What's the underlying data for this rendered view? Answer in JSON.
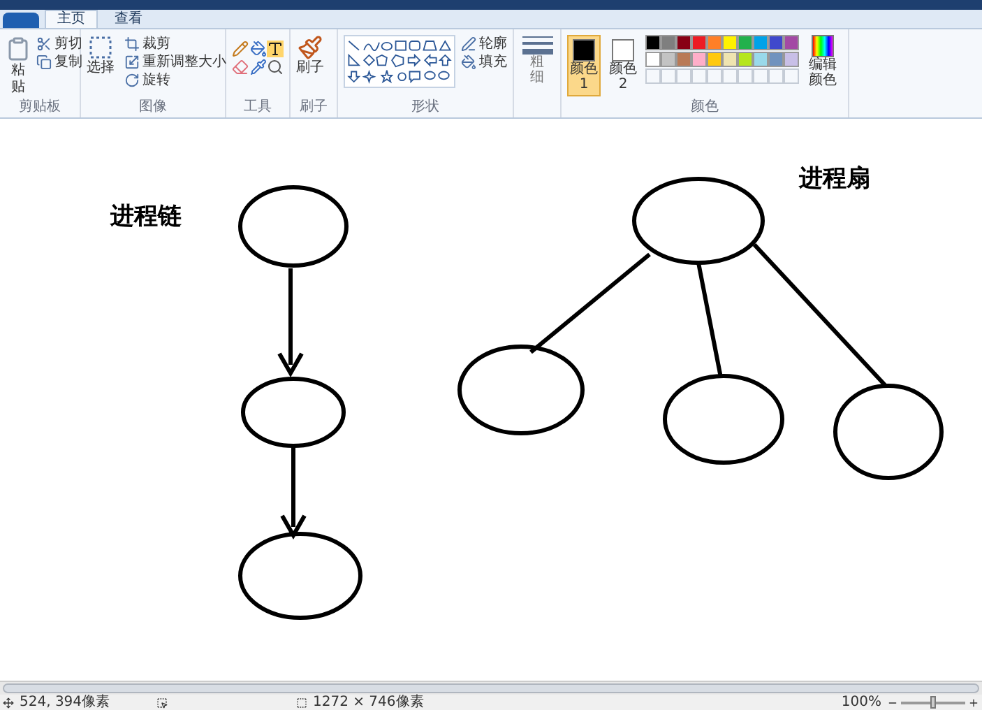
{
  "tabs": [
    {
      "label": "主页",
      "selected": true
    },
    {
      "label": "查看",
      "selected": false
    }
  ],
  "ribbon": {
    "clipboard": {
      "label": "剪贴板",
      "paste": "粘贴",
      "cut": "剪切",
      "copy": "复制"
    },
    "image": {
      "label": "图像",
      "select": "选择",
      "crop": "裁剪",
      "resize": "重新调整大小",
      "rotate": "旋转"
    },
    "tools": {
      "label": "工具"
    },
    "brushes": {
      "label": "刷子",
      "button": "刷子"
    },
    "shapes": {
      "label": "形状",
      "outline": "轮廓",
      "fill": "填充"
    },
    "size": {
      "label": "粗细"
    },
    "colors": {
      "label": "颜色",
      "edit": "编辑颜色",
      "slots": [
        {
          "label": "颜色 1",
          "color": "#000000",
          "selected": true
        },
        {
          "label": "颜色 2",
          "color": "#ffffff",
          "selected": false
        }
      ],
      "palette": [
        {
          "color": "#000000"
        },
        {
          "color": "#7f7f7f"
        },
        {
          "color": "#880015"
        },
        {
          "color": "#ed1c24"
        },
        {
          "color": "#ff7f27"
        },
        {
          "color": "#fff200"
        },
        {
          "color": "#22b14c"
        },
        {
          "color": "#00a2e8"
        },
        {
          "color": "#3f48cc"
        },
        {
          "color": "#a349a4"
        },
        {
          "color": "#ffffff"
        },
        {
          "color": "#c3c3c3"
        },
        {
          "color": "#b97a57"
        },
        {
          "color": "#ffaec9"
        },
        {
          "color": "#ffc90e"
        },
        {
          "color": "#efe4b0"
        },
        {
          "color": "#b5e61d"
        },
        {
          "color": "#99d9ea"
        },
        {
          "color": "#7092be"
        },
        {
          "color": "#c8bfe7"
        }
      ]
    }
  },
  "canvas": {
    "labels": [
      {
        "text": "进程链"
      },
      {
        "text": "进程扇"
      }
    ]
  },
  "status_bar": {
    "position": "524, 394像素",
    "size": "1272 × 746像素",
    "zoom": "100%",
    "zoom_level": {
      "level": 0.5
    }
  }
}
